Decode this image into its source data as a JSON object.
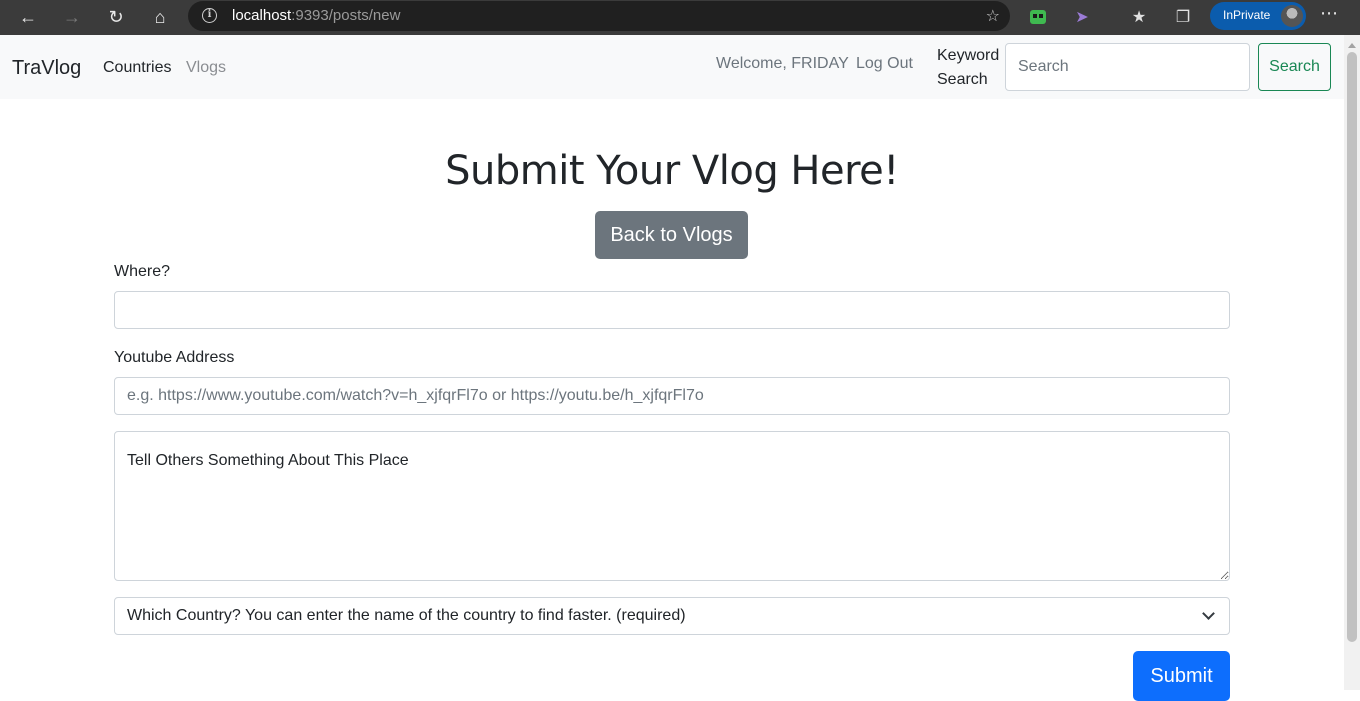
{
  "browser": {
    "url_host": "localhost",
    "url_rest": ":9393/posts/new",
    "inprivate_label": "InPrivate"
  },
  "navbar": {
    "brand": "TraVlog",
    "links": [
      "Countries",
      "Vlogs"
    ],
    "welcome": "Welcome, FRIDAY",
    "logout": "Log Out",
    "keyword_label": "Keyword Search",
    "search_placeholder": "Search",
    "search_button": "Search"
  },
  "page": {
    "title": "Submit Your Vlog Here!",
    "back_button": "Back to Vlogs",
    "where_label": "Where?",
    "where_value": "",
    "youtube_label": "Youtube Address",
    "youtube_placeholder": "e.g. https://www.youtube.com/watch?v=h_xjfqrFl7o or https://youtu.be/h_xjfqrFl7o",
    "description_placeholder": "Tell Others Something About This Place",
    "country_select": "Which Country? You can enter the name of the country to find faster. (required)",
    "submit_button": "Submit"
  },
  "colors": {
    "primary": "#0d6efd",
    "secondary": "#6c757d",
    "success": "#198754"
  }
}
